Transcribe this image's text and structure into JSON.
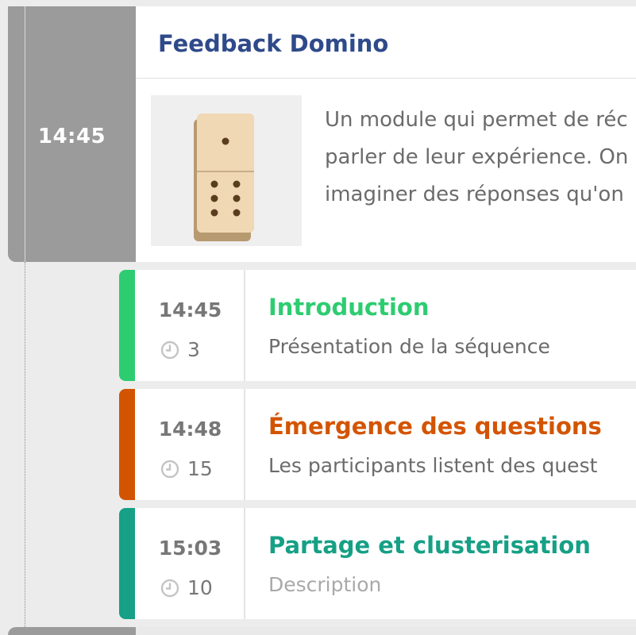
{
  "module": {
    "time": "14:45",
    "title": "Feedback Domino",
    "thumbnail_icon": "domino-icon",
    "description_lines": [
      "Un module qui permet de réc",
      "parler de leur expérience. On",
      "imaginer des réponses qu'on"
    ]
  },
  "sequences": [
    {
      "time": "14:45",
      "duration": "3",
      "title": "Introduction",
      "description": "Présentation de la séquence",
      "color": "#2ecc71",
      "placeholder": false
    },
    {
      "time": "14:48",
      "duration": "15",
      "title": "Émergence des questions",
      "description": "Les participants listent des quest",
      "color": "#d35400",
      "placeholder": false
    },
    {
      "time": "15:03",
      "duration": "10",
      "title": "Partage et clusterisation",
      "description": "Description",
      "color": "#16a085",
      "placeholder": true
    }
  ],
  "icons": {
    "duration": "clock-icon"
  }
}
